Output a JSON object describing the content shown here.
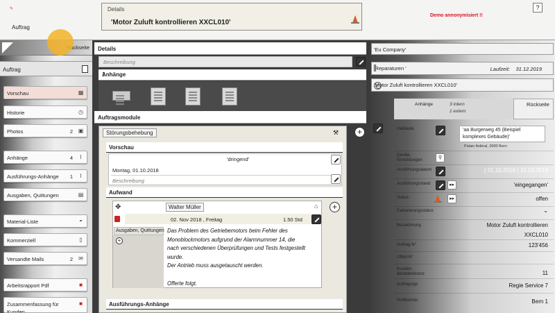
{
  "header": {
    "app_label": "Auftrag",
    "details_label": "Details",
    "details_value": "'Motor Zuluft kontrollieren XXCL010'",
    "demo_text": "Demo annonymisiert !!",
    "help": "?"
  },
  "sidebar": {
    "back": "Rückseite",
    "section": "Auftrag",
    "items": [
      {
        "label": "Vorschau",
        "count": "",
        "icon": "calendar-icon"
      },
      {
        "label": "Historie",
        "count": "",
        "icon": "clock-icon"
      },
      {
        "label": "Photos",
        "count": "2",
        "icon": "camera-icon"
      },
      {
        "label": "Anhänge",
        "count": "4",
        "icon": "paperclip-icon"
      },
      {
        "label": "Ausführungs-Anhänge",
        "count": "1",
        "icon": "paperclip-icon"
      },
      {
        "label": "Ausgaben, Quittungen",
        "count": "",
        "icon": "receipt-icon"
      },
      {
        "label": "Material-Liste",
        "count": "",
        "icon": "basket-icon"
      },
      {
        "label": "Kommerziell",
        "count": "",
        "icon": "document-icon"
      },
      {
        "label": "Versandte Mails",
        "count": "2",
        "icon": "mail-icon"
      },
      {
        "label": "Arbeitsrapport Pdf",
        "count": "",
        "icon": "pdf-icon"
      },
      {
        "label": "Zusammenfassung für Kunden",
        "count": "",
        "icon": "pdf-icon"
      }
    ]
  },
  "center": {
    "details_title": "Details",
    "description_placeholder": "Beschreibung",
    "attachments_title": "Anhänge",
    "modules_title": "Auftragsmodule",
    "module_badge": "Störungsbehebung",
    "preview_title": "Vorschau",
    "preview_priority": "'dringend'",
    "preview_date": "Montag, 01.10.2018",
    "preview_desc": "Beschreibung",
    "effort_title": "Aufwand",
    "worker": "Walter Müller",
    "effort_date": "02. Nov 2018 , Freitag",
    "effort_hours": "1.50 Std",
    "effort_side_label": "Ausgaben, Quittungen",
    "effort_lines": [
      "Das Problem des Getriebemotors beim Fehler des",
      "Monoblockmotors aufgrund der Alarmnummer 14, die",
      "nach verschiedenen Überprüfungen und Tests festgestellt",
      "wurde.",
      "Der Antrieb muss ausgetauscht werden.",
      "",
      "Offerte folgt."
    ],
    "exec_attachments_title": "Ausführungs-Anhänge"
  },
  "right": {
    "company": "'Eu Company'",
    "category": "'Reparaturen '",
    "runtime_label": "Laufzeit:",
    "runtime_value": "31.12.2019",
    "order_title": "'Motor Zuluft kontrollieren XXCL010'",
    "attach_label": "Anhänge",
    "attach_internal": "3 intern",
    "attach_external": "1 extern",
    "back": "Rückseite",
    "fields": {
      "building_label": "Gebäude",
      "building_line1": "'aa Burgerweg 45 (Beispiel",
      "building_line2": "komplexes Gebäude)'",
      "building_small": "Palais fédéral, 3000 Bern",
      "equipment_label": "Geräte, Einrichtungen",
      "exec_date_label": "Ausführungsdatum",
      "exec_date_value": "( 01.10.2018 ) 15.03.2019",
      "exec_status_label": "Ausführungsstand",
      "exec_status_value": "'eingegangen'",
      "status_label": "Status",
      "status_value": "offen",
      "invoice_label": "Fakturierungsstatus",
      "designation_label": "Bezeichnung",
      "designation_value1": "Motor Zuluft kontrollieren",
      "designation_value2": "XXCL010",
      "order_no_label": "Auftrag-N°",
      "order_no_value": "123'456",
      "offer_label": "Offert-N°",
      "client_ref_label": "Kunden-Bestellreferenz",
      "client_ref_value": "11",
      "order_type_label": "Auftragstyp",
      "order_type_value": "Regie Service 7",
      "profitcenter_label": "Profitcenter",
      "profitcenter_value": "Bern 1"
    }
  }
}
